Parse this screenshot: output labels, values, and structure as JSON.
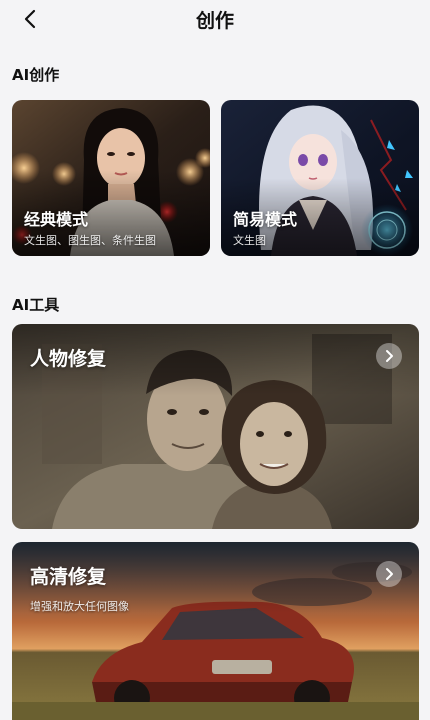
{
  "header": {
    "title": "创作"
  },
  "sections": {
    "ai_create": "AI创作",
    "ai_tools": "AI工具"
  },
  "create_cards": [
    {
      "title": "经典模式",
      "subtitle": "文生图、图生图、条件生图"
    },
    {
      "title": "简易模式",
      "subtitle": "文生图"
    }
  ],
  "tool_cards": [
    {
      "title": "人物修复",
      "subtitle": ""
    },
    {
      "title": "高清修复",
      "subtitle": "增强和放大任何图像"
    }
  ],
  "icons": {
    "back": "chevron-left-icon",
    "arrow": "chevron-right-icon"
  },
  "colors": {
    "background": "#f4f4f6",
    "text": "#111111",
    "card_overlay_text": "#ffffff"
  }
}
